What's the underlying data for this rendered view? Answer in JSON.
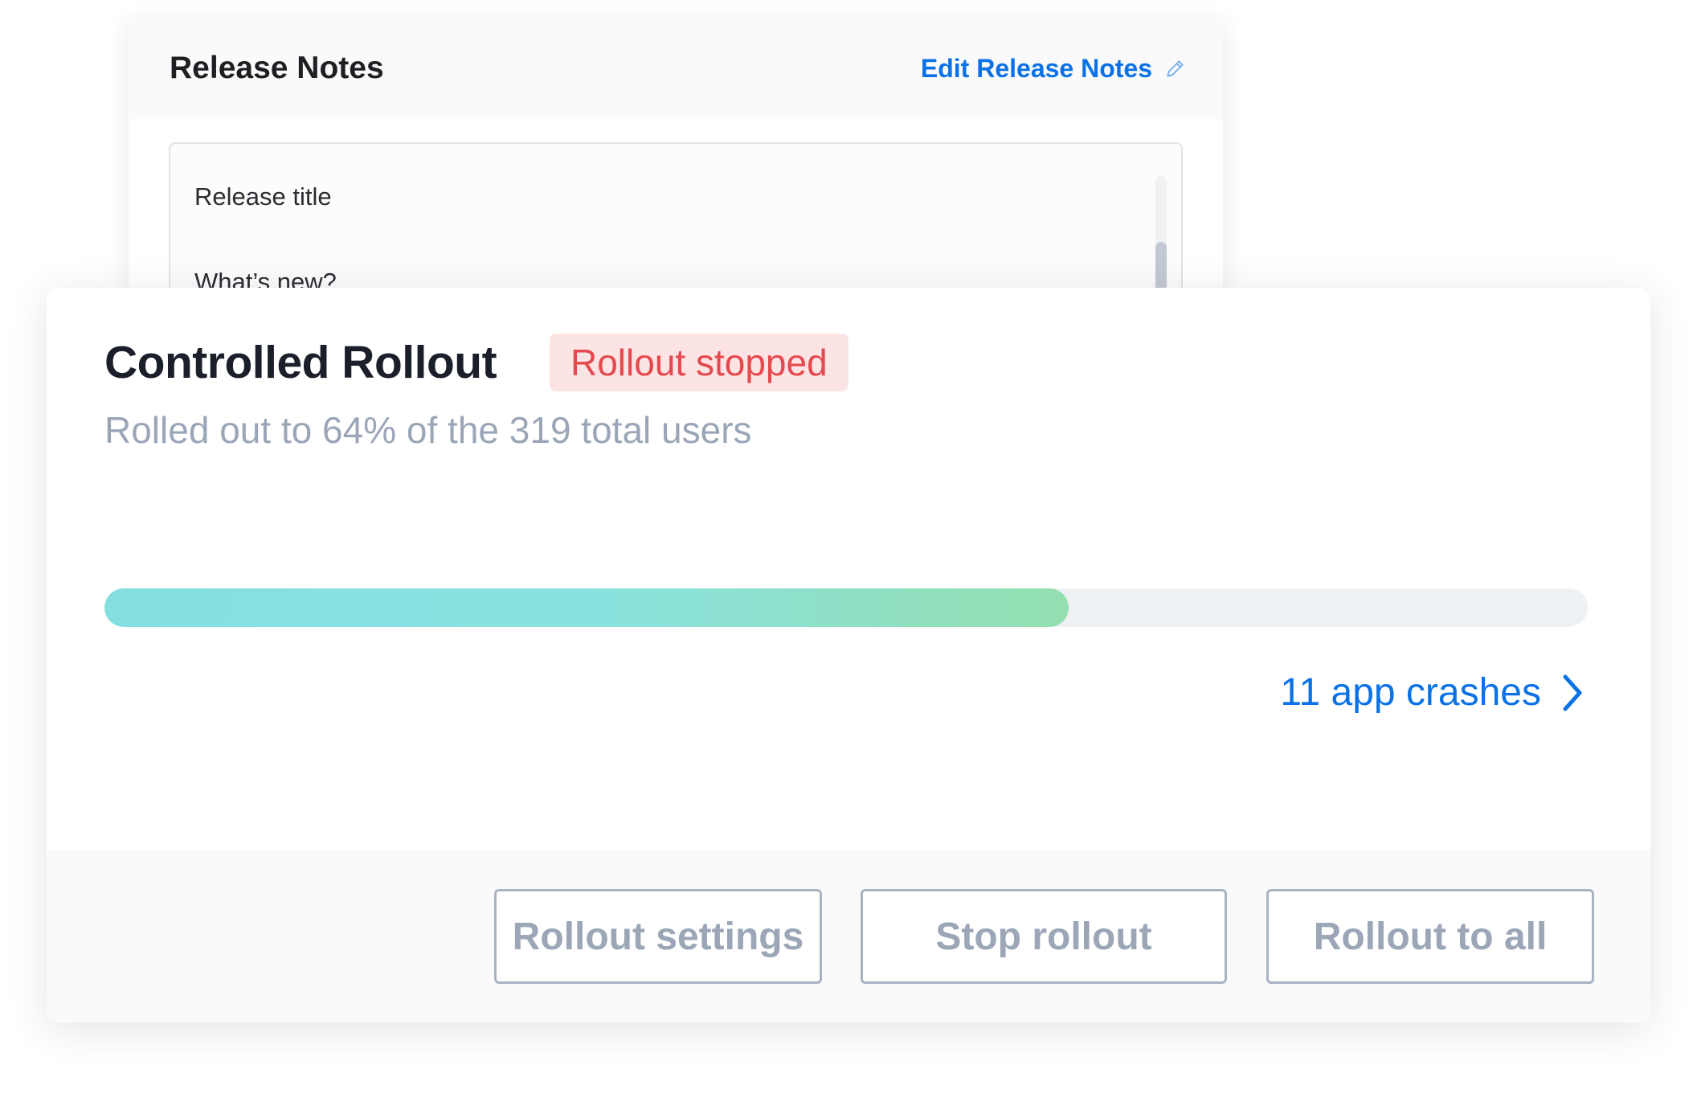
{
  "release_notes": {
    "title": "Release Notes",
    "edit_label": "Edit Release Notes",
    "edit_icon": "pencil-icon",
    "lines": [
      "Release title",
      "What’s new?"
    ]
  },
  "rollout": {
    "title": "Controlled Rollout",
    "status": "Rollout stopped",
    "status_color": "#e5484d",
    "subtitle": "Rolled out to 64% of the 319 total users",
    "progress_fraction": 0.65,
    "crashes_label": "11 app crashes",
    "crashes_icon": "chevron-right-icon",
    "accent_color": "#0a72e6"
  },
  "footer": {
    "settings_label": "Rollout settings",
    "stop_label": "Stop rollout",
    "all_label": "Rollout to all"
  }
}
